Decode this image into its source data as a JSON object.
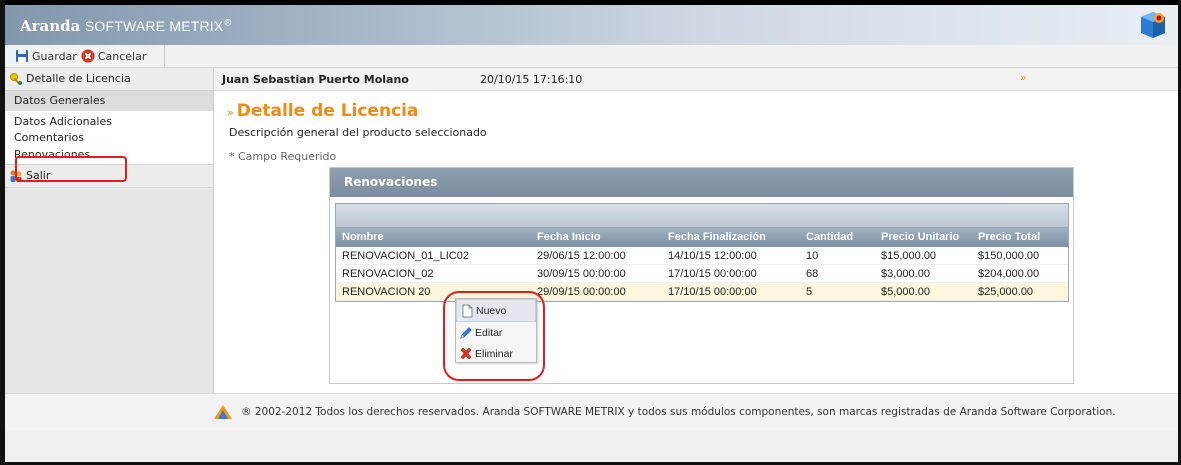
{
  "header": {
    "brand_bold": "Aranda",
    "brand_rest": "SOFTWARE METRIX",
    "brand_mark": "®"
  },
  "toolbar": {
    "save_label": "Guardar",
    "cancel_label": "Cancelar"
  },
  "sidebar": {
    "section_label": "Detalle de Licencia",
    "items": [
      {
        "label": "Datos Generales"
      },
      {
        "label": "Datos Adicionales"
      },
      {
        "label": "Comentarios"
      },
      {
        "label": "Renovaciones"
      }
    ],
    "exit_label": "Salir"
  },
  "infobar": {
    "user": "Juan Sebastian Puerto Molano",
    "timestamp": "20/10/15 17:16:10",
    "arrow": "»"
  },
  "main": {
    "title_prefix": "»",
    "title": "Detalle de Licencia",
    "subtitle": "Descripción general del producto seleccionado",
    "required_note": "* Campo Requerido"
  },
  "panel": {
    "title": "Renovaciones",
    "columns": [
      "Nombre",
      "Fecha Inicio",
      "Fecha Finalización",
      "Cantidad",
      "Precio Unitario",
      "Precio Total"
    ],
    "rows": [
      [
        "RENOVACION_01_LIC02",
        "29/06/15 12:00:00",
        "14/10/15 12:00:00",
        "10",
        "$15,000.00",
        "$150,000.00"
      ],
      [
        "RENOVACION_02",
        "30/09/15 00:00:00",
        "17/10/15 00:00:00",
        "68",
        "$3,000.00",
        "$204,000.00"
      ],
      [
        "RENOVACION 20",
        "29/09/15 00:00:00",
        "17/10/15 00:00:00",
        "5",
        "$5,000.00",
        "$25,000.00"
      ]
    ]
  },
  "context_menu": {
    "items": [
      {
        "label": "Nuevo",
        "icon": "new-document-icon"
      },
      {
        "label": "Editar",
        "icon": "pencil-icon"
      },
      {
        "label": "Eliminar",
        "icon": "red-x-icon"
      }
    ]
  },
  "footer": {
    "text": "® 2002-2012 Todos los derechos reservados. Aranda SOFTWARE METRIX y todos sus módulos componentes, son marcas registradas de Aranda Software Corporation."
  },
  "colors": {
    "accent_orange": "#f08a13",
    "highlight_red": "#e21d1d",
    "panel_header": "#7c8d9f"
  }
}
